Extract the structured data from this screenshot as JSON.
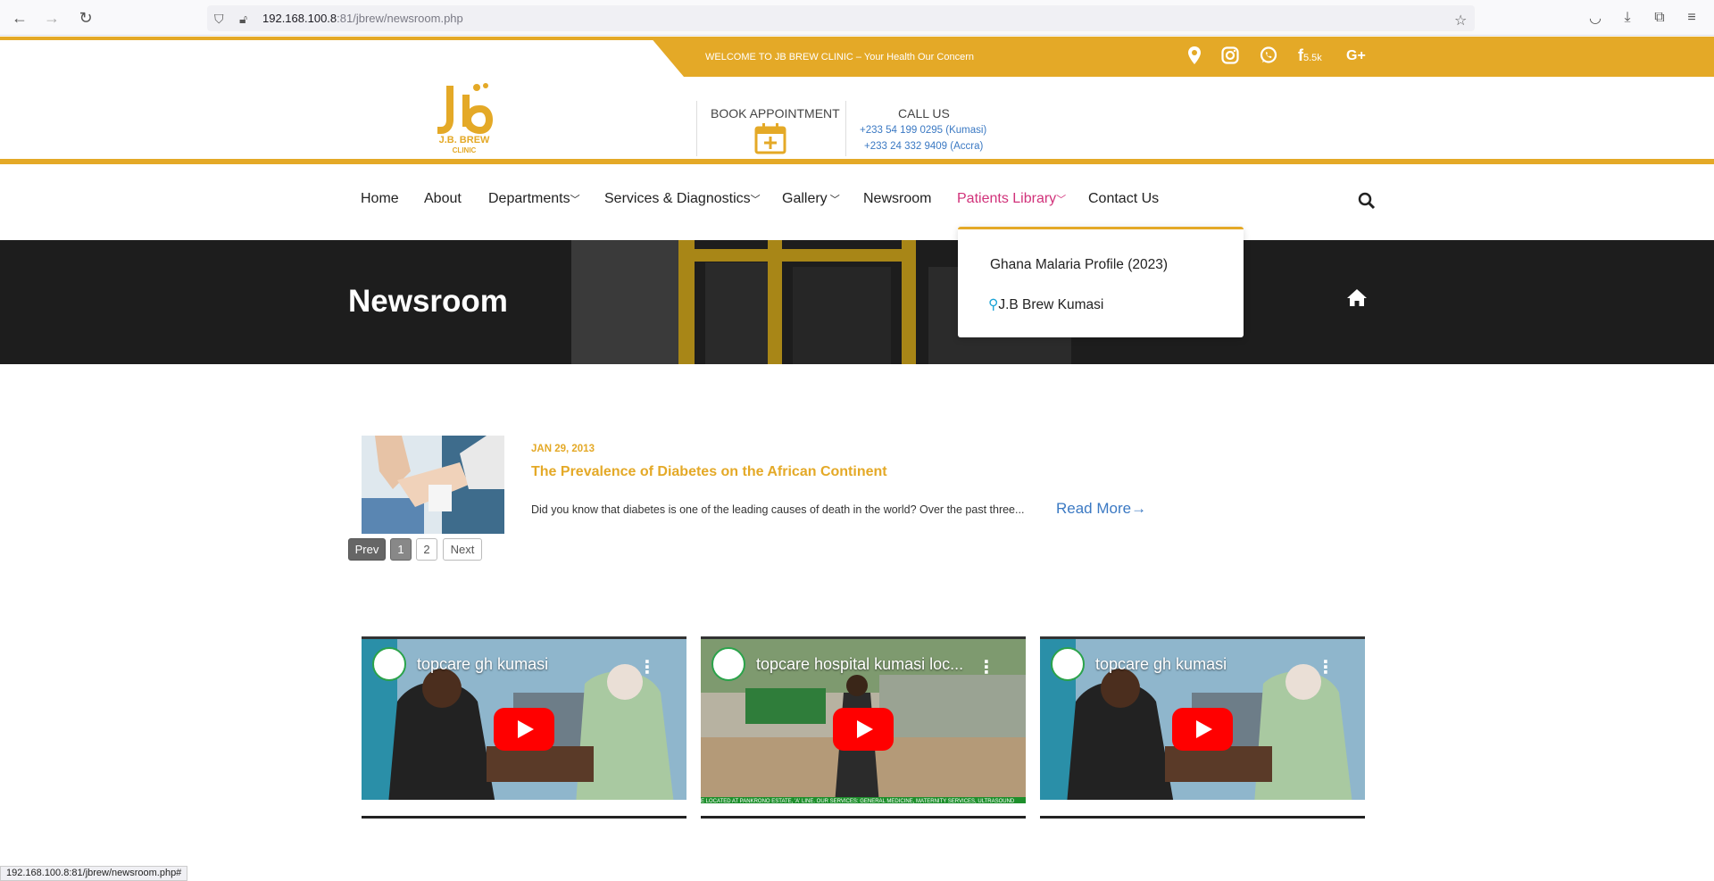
{
  "browser": {
    "url_host": "192.168.100.8",
    "url_rest": ":81/jbrew/newsroom.php",
    "status_url": "192.168.100.8:81/jbrew/newsroom.php#"
  },
  "topbar": {
    "welcome": "WELCOME TO JB BREW CLINIC – Your Health Our Concern",
    "facebook_count": "5.5k",
    "google_plus": "G+"
  },
  "header": {
    "logo_name": "J.B. BREW",
    "logo_sub": "CLINIC",
    "book_label": "BOOK APPOINTMENT",
    "call_label": "CALL US",
    "phone_kumasi": "+233 54 199 0295 (Kumasi)",
    "phone_accra": "+233 24 332 9409 (Accra)"
  },
  "nav": {
    "home": "Home",
    "about": "About",
    "departments": "Departments",
    "services": "Services & Diagnostics",
    "gallery": "Gallery",
    "newsroom": "Newsroom",
    "patients_library": "Patients Library",
    "contact": "Contact Us"
  },
  "dropdown": {
    "item1": "Ghana Malaria Profile (2023)",
    "item2": "J.B Brew Kumasi"
  },
  "hero": {
    "title": "Newsroom"
  },
  "article": {
    "date": "JAN 29, 2013",
    "title": "The Prevalence of Diabetes on the African Continent",
    "excerpt": "Did you know that diabetes is one of the leading causes of death in the world? Over the past three...",
    "read_more": "Read More→"
  },
  "pager": {
    "prev": "Prev",
    "p1": "1",
    "p2": "2",
    "next": "Next"
  },
  "videos": [
    {
      "title": "topcare gh kumasi"
    },
    {
      "title": "topcare hospital kumasi loc...",
      "ticker": "E LOCATED AT PANKRONO ESTATE, 'A' LINE. OUR SERVICES: GENERAL MEDICINE, MATERNITY SERVICES, ULTRASOUND"
    },
    {
      "title": "topcare gh kumasi"
    }
  ],
  "colors": {
    "brand_gold": "#e4a927",
    "nav_active": "#d1327a",
    "link_blue": "#3b79c3"
  }
}
